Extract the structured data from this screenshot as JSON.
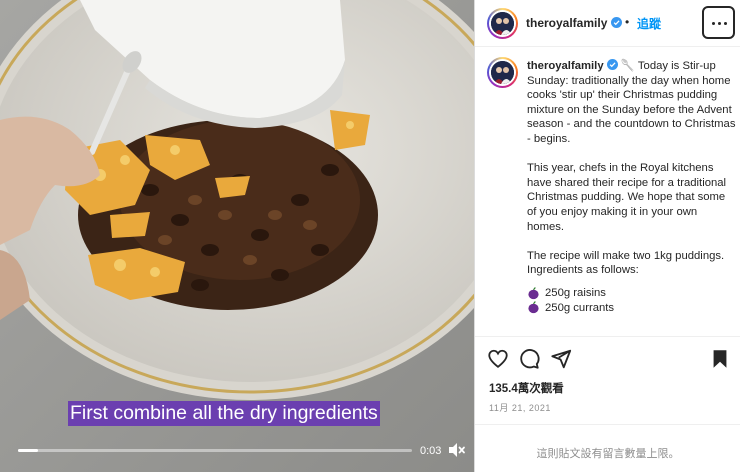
{
  "video": {
    "caption": "First combine all the dry ingredients",
    "time": "0:03",
    "progress": 0.05,
    "mute_icon": "speaker-muted-icon"
  },
  "header": {
    "username": "theroyalfamily",
    "separator": "•",
    "follow_label": "追蹤",
    "more_icon": "more-horizontal-icon"
  },
  "post": {
    "username": "theroyalfamily",
    "paragraphs": [
      "🥄 Today is Stir-up Sunday: traditionally the day when home cooks 'stir up' their Christmas pudding mixture on the Sunday before the Advent season - and the countdown to Christmas - begins.",
      "This year, chefs in the Royal kitchens have shared their recipe for a traditional Christmas pudding. We hope that some of you enjoy making it in your own homes.",
      "The recipe will make two 1kg puddings. Ingredients as follows:"
    ],
    "ingredients": [
      "250g raisins",
      "250g currants"
    ]
  },
  "actions": {
    "like_icon": "heart-icon",
    "comment_icon": "comment-icon",
    "share_icon": "share-icon",
    "save_icon": "bookmark-icon"
  },
  "stats": {
    "views": "135.4萬次觀看",
    "date": "11月 21, 2021"
  },
  "footer": {
    "comments_limited": "這則貼文設有留言數量上限。"
  },
  "colors": {
    "link": "#0095f6",
    "verified": "#3897f0",
    "caption_bg": "#6b3fb0",
    "text": "#262626",
    "muted": "#8e8e8e"
  }
}
